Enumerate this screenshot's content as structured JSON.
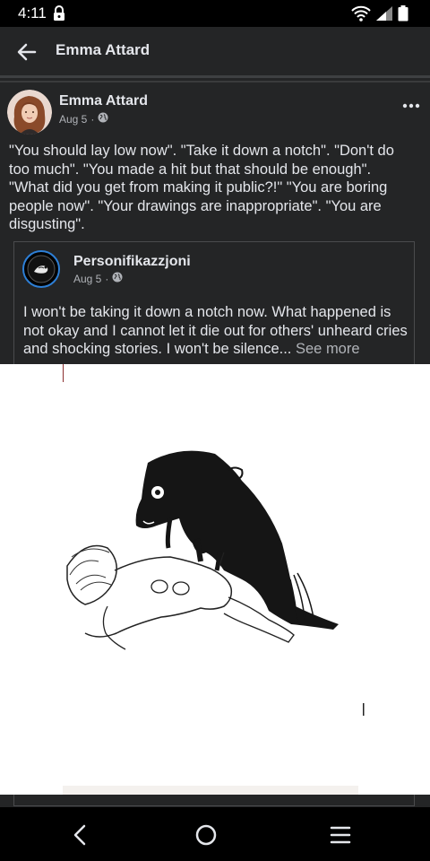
{
  "status_bar": {
    "time": "4:11",
    "icons": [
      "lock-icon",
      "wifi-icon",
      "signal-icon",
      "battery-icon"
    ]
  },
  "app_bar": {
    "title": "Emma Attard",
    "back_icon": "arrow-left-icon"
  },
  "post": {
    "author": "Emma Attard",
    "date": "Aug 5",
    "separator": "·",
    "audience_icon": "globe-icon",
    "more_icon": "more-horizontal-icon",
    "text": "\"You should lay low now\". \"Take it down a notch\". \"Don't do too much\". \"You made a hit but that should be enough\". \"What did you get from making it public?!\" \"You are boring people now\". \"Your drawings are inappropriate\". \"You are disgusting\"."
  },
  "shared_post": {
    "author": "Personifikazzjoni",
    "date": "Aug 5",
    "separator": "·",
    "audience_icon": "globe-icon",
    "text": "I won't be taking it down a notch now. What happened is not okay and I cannot let it die out for others' unheard cries and shocking stories. I won't be silence...",
    "see_more": "See more"
  },
  "nav_bar": {
    "icons": [
      "back-chevron-icon",
      "home-circle-icon",
      "menu-lines-icon"
    ]
  },
  "colors": {
    "background": "#242526",
    "text": "#e4e6eb",
    "secondary_text": "#b0b3b8",
    "status_bar": "#000000"
  }
}
